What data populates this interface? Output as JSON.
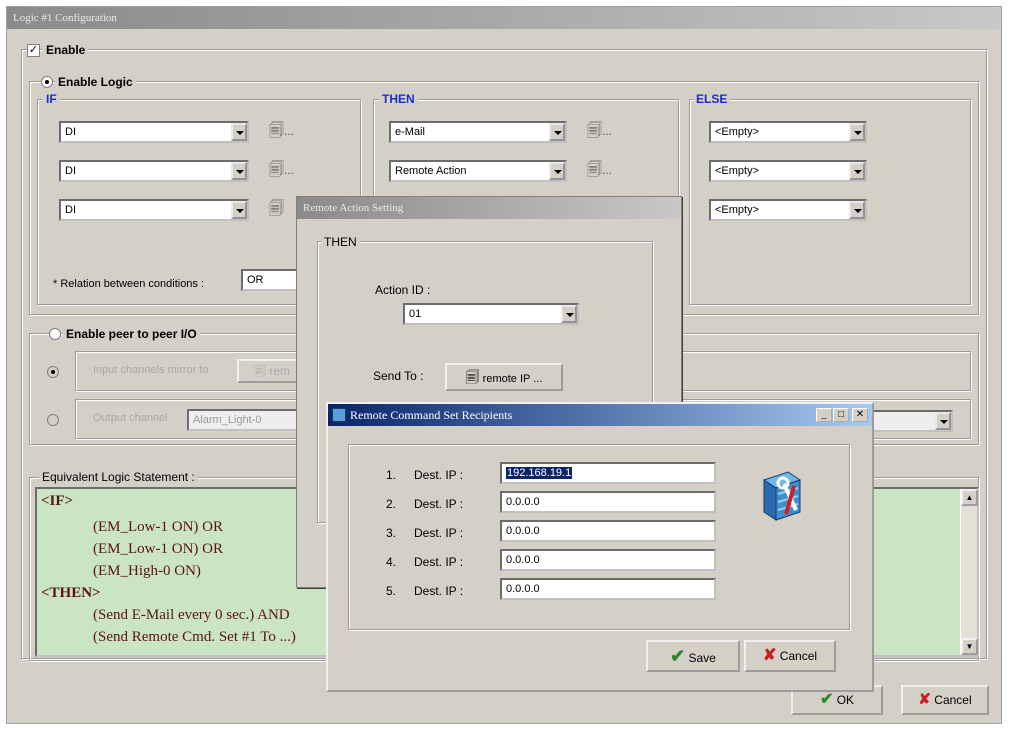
{
  "main_window": {
    "title": "Logic #1 Configuration",
    "enable_label": "Enable",
    "enable_logic_label": "Enable Logic",
    "if_label": "IF",
    "then_label": "THEN",
    "else_label": "ELSE",
    "if_conditions": [
      "DI",
      "DI",
      "DI"
    ],
    "then_actions": [
      "e-Mail",
      "Remote Action"
    ],
    "else_actions": [
      "<Empty>",
      "<Empty>",
      "<Empty>"
    ],
    "relation_label": "* Relation between conditions :",
    "relation_value": "OR",
    "peer_label": "Enable peer to peer I/O",
    "input_mirror_label": "Input channels mirror to",
    "input_mirror_button": "rem",
    "output_label": "Output channel",
    "output_value": "Alarm_Light-0",
    "equivalent_label": "Equivalent Logic Statement :",
    "statement": {
      "if_kw": "<IF>",
      "if_lines": [
        "(EM_Low-1 ON)  OR",
        "(EM_Low-1 ON)  OR",
        "(EM_High-0 ON)"
      ],
      "then_kw": "<THEN>",
      "then_lines": [
        "(Send E-Mail every 0 sec.)  AND",
        "(Send Remote Cmd. Set #1 To ...)"
      ]
    },
    "ok_label": "OK",
    "cancel_label": "Cancel"
  },
  "remote_action_dialog": {
    "title": "Remote Action Setting",
    "group_label": "THEN",
    "action_id_label": "Action ID :",
    "action_id_value": "01",
    "send_to_label": "Send To :",
    "remote_ip_button": "remote IP ..."
  },
  "recipients_dialog": {
    "title": "Remote Command Set Recipients",
    "rows": [
      {
        "num": "1.",
        "label": "Dest. IP :",
        "value": "192.168.19.1"
      },
      {
        "num": "2.",
        "label": "Dest. IP :",
        "value": "0.0.0.0"
      },
      {
        "num": "3.",
        "label": "Dest. IP :",
        "value": "0.0.0.0"
      },
      {
        "num": "4.",
        "label": "Dest. IP :",
        "value": "0.0.0.0"
      },
      {
        "num": "5.",
        "label": "Dest. IP :",
        "value": "0.0.0.0"
      }
    ],
    "save_label": "Save",
    "cancel_label": "Cancel"
  },
  "colors": {
    "face": "#d4d0c8",
    "accent_blue": "#1a2fc8",
    "logic_bg": "#cbe4c4",
    "title_active": "#0a246a"
  },
  "icons": [
    "browse-icon",
    "tools-icon",
    "checkmark-icon",
    "x-icon",
    "minimize-icon",
    "maximize-icon",
    "close-icon"
  ]
}
